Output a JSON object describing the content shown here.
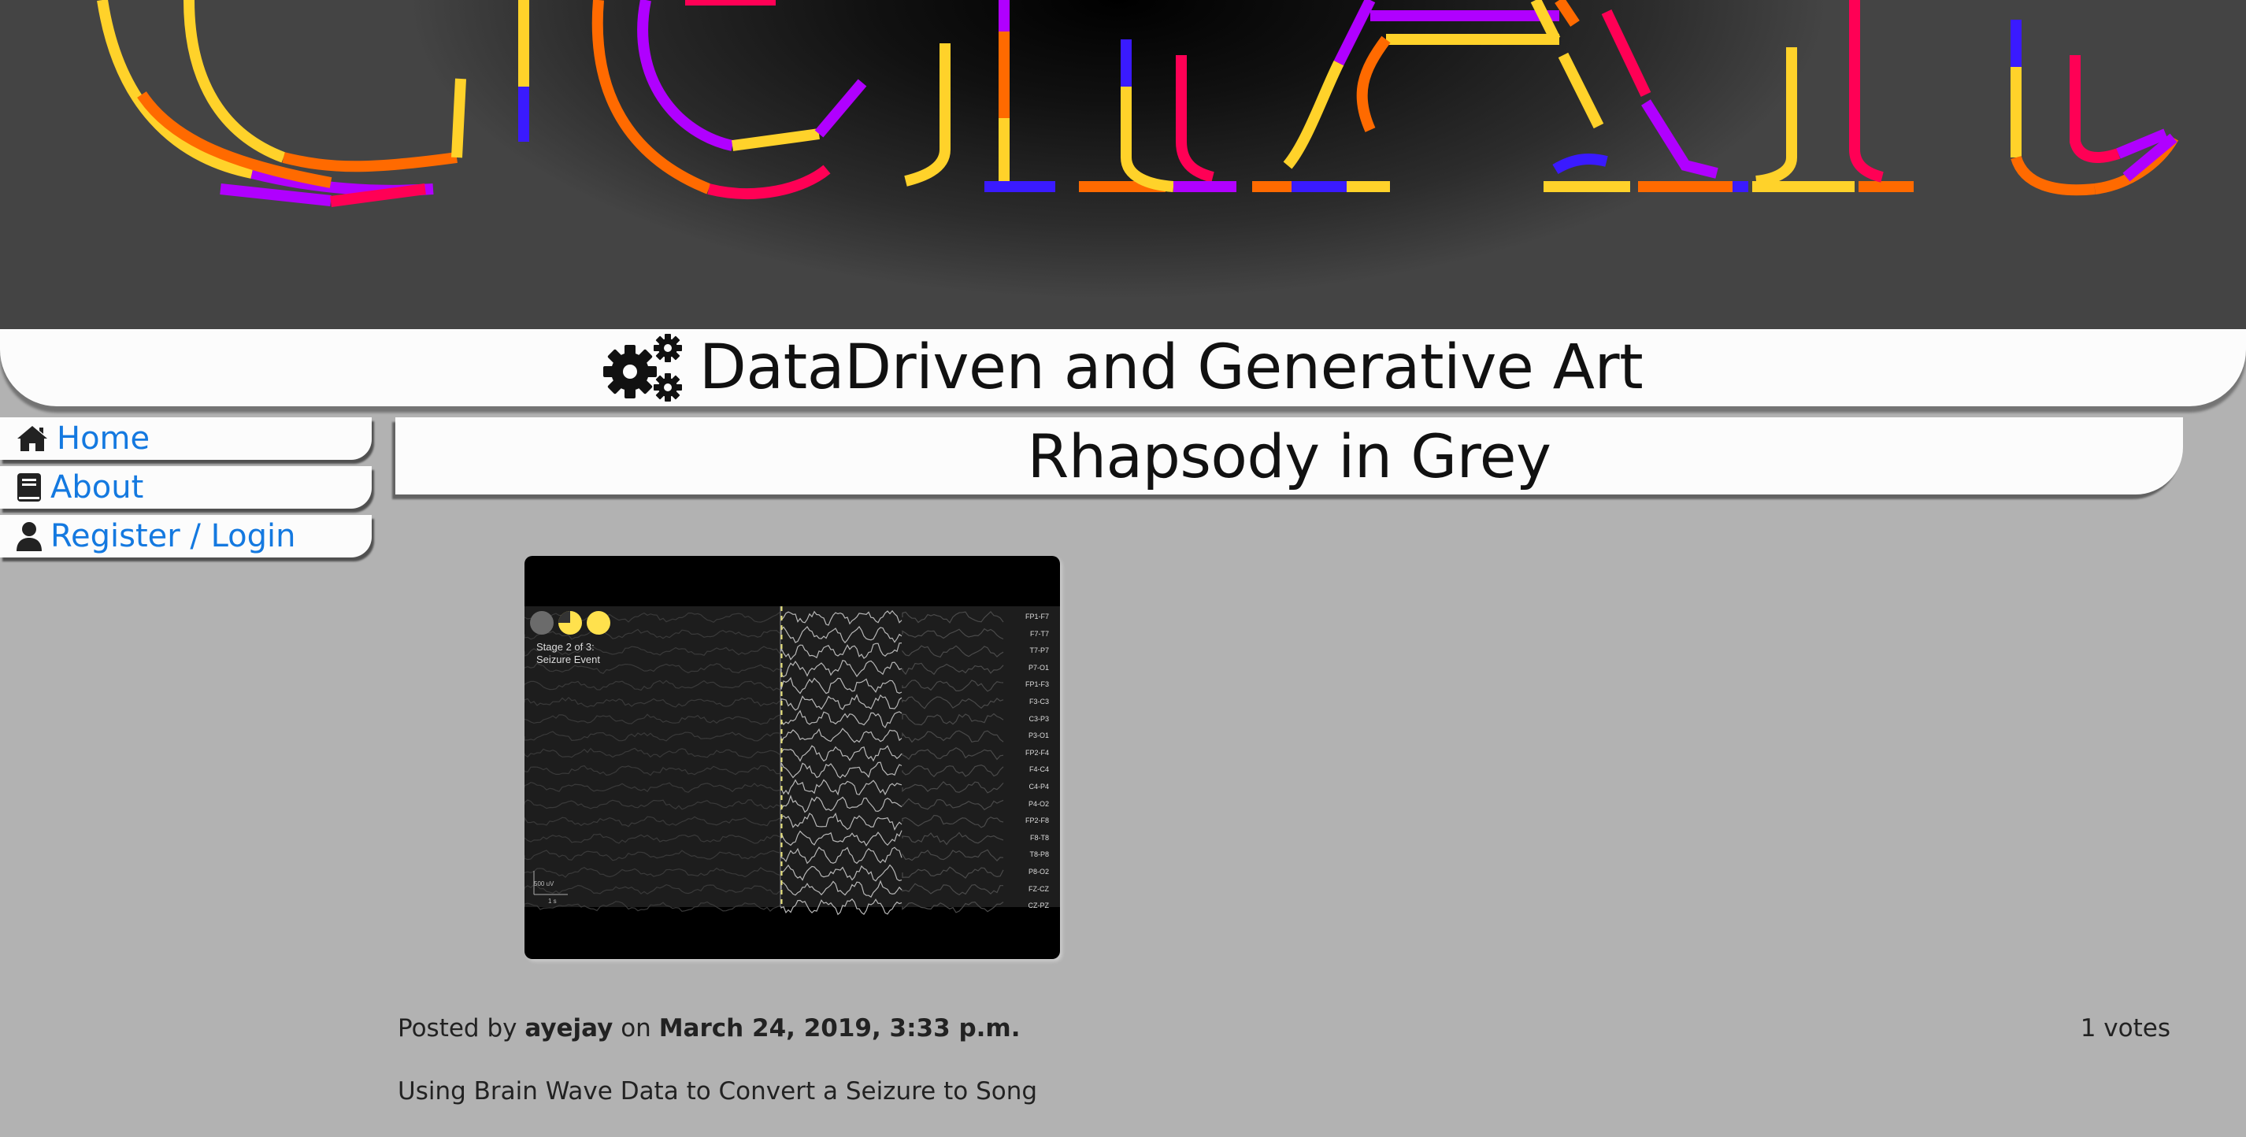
{
  "site": {
    "title": "DataDriven and Generative Art",
    "banner_icon": "gears-icon"
  },
  "colors": {
    "page_bg": "#b2b2b2",
    "link": "#1479e0",
    "banner_palette": [
      "#ffd22a",
      "#ff6a00",
      "#ff0055",
      "#b000ff",
      "#3a1aff"
    ]
  },
  "nav": {
    "items": [
      {
        "label": "Home",
        "icon": "home-icon"
      },
      {
        "label": "About",
        "icon": "book-icon"
      },
      {
        "label": "Register / Login",
        "icon": "user-icon"
      }
    ]
  },
  "post": {
    "title": "Rhapsody in Grey",
    "posted_by_prefix": "Posted by",
    "author": "ayejay",
    "on_word": "on",
    "date": "March 24, 2019, 3:33 p.m.",
    "votes": "1 votes",
    "description": "Using Brain Wave Data to Convert a Seizure to Song"
  },
  "video": {
    "stage_line1": "Stage 2 of 3:",
    "stage_line2": "Seizure Event",
    "channels": [
      "FP1-F7",
      "F7-T7",
      "T7-P7",
      "P7-O1",
      "FP1-F3",
      "F3-C3",
      "C3-P3",
      "P3-O1",
      "FP2-F4",
      "F4-C4",
      "C4-P4",
      "P4-O2",
      "FP2-F8",
      "F8-T8",
      "T8-P8",
      "P8-O2",
      "FZ-CZ",
      "CZ-PZ"
    ],
    "scale_amplitude": "500 uV",
    "scale_time": "1 s"
  }
}
